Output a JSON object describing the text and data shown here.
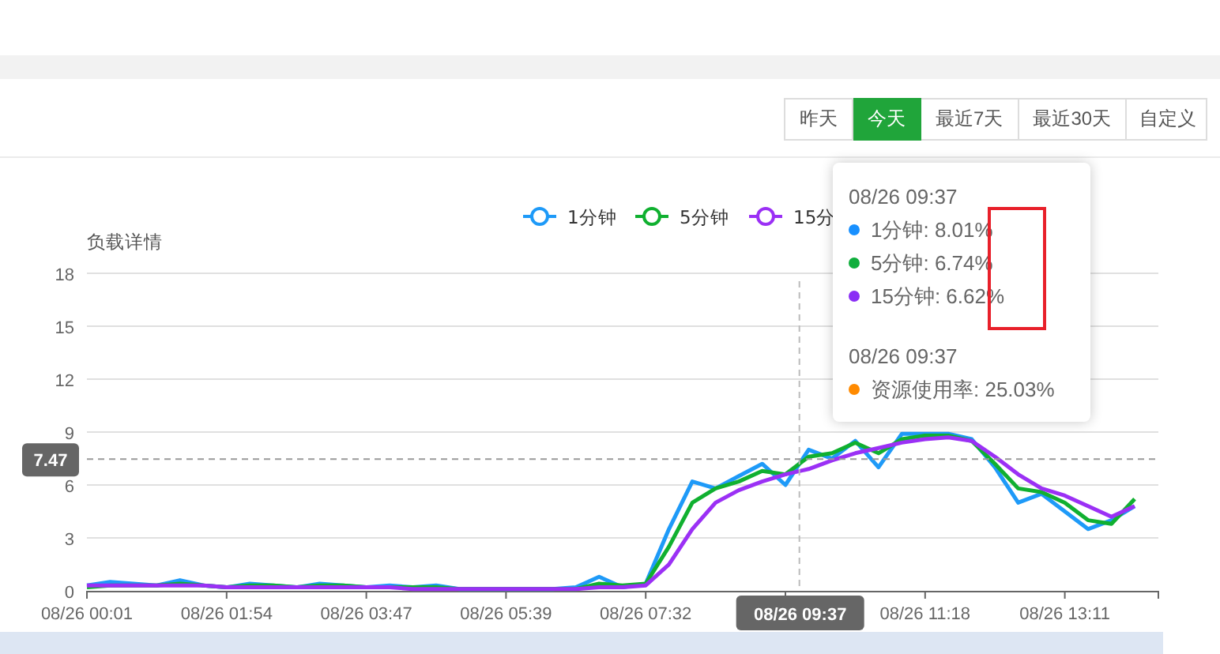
{
  "range_buttons": [
    {
      "label": "昨天",
      "selected": false
    },
    {
      "label": "今天",
      "selected": true
    },
    {
      "label": "最近7天",
      "selected": false
    },
    {
      "label": "最近30天",
      "selected": false
    },
    {
      "label": "自定义",
      "selected": false
    }
  ],
  "chart": {
    "title": "负载详情",
    "x_pointer_label": "08/26 09:37",
    "chart_data": {
      "type": "line",
      "grid": true,
      "legend": true,
      "ylim": [
        0,
        18
      ],
      "yticks": [
        0,
        3,
        6,
        9,
        12,
        15,
        18
      ],
      "ref_lines": [
        {
          "axis": "y",
          "value": 7.47,
          "label": "7.47"
        }
      ],
      "categories": [
        "08/26 00:01",
        null,
        null,
        null,
        null,
        null,
        "08/26 01:54",
        null,
        null,
        null,
        null,
        null,
        "08/26 03:47",
        null,
        null,
        null,
        null,
        null,
        "08/26 05:39",
        null,
        null,
        null,
        null,
        null,
        "08/26 07:32",
        null,
        null,
        null,
        null,
        null,
        null,
        null,
        null,
        null,
        null,
        null,
        "08/26 11:18",
        null,
        null,
        null,
        null,
        null,
        "08/26 13:11",
        null,
        null,
        null
      ],
      "series": [
        {
          "name": "1分钟",
          "color": "#1e9af8",
          "values": [
            0.3,
            0.5,
            0.4,
            0.3,
            0.6,
            0.3,
            0.2,
            0.4,
            0.3,
            0.2,
            0.4,
            0.3,
            0.2,
            0.3,
            0.2,
            0.3,
            0.1,
            0.1,
            0.1,
            0.1,
            0.1,
            0.2,
            0.8,
            0.2,
            0.4,
            3.5,
            6.2,
            5.8,
            6.5,
            7.2,
            6.0,
            8.0,
            7.5,
            8.5,
            7.0,
            8.9,
            8.9,
            8.9,
            8.6,
            7.0,
            5.0,
            5.5,
            4.5,
            3.5,
            4.0,
            4.8
          ]
        },
        {
          "name": "5分钟",
          "color": "#10b030",
          "values": [
            0.2,
            0.3,
            0.3,
            0.3,
            0.4,
            0.3,
            0.2,
            0.3,
            0.3,
            0.2,
            0.3,
            0.3,
            0.2,
            0.2,
            0.2,
            0.2,
            0.1,
            0.1,
            0.1,
            0.1,
            0.1,
            0.1,
            0.4,
            0.3,
            0.4,
            2.5,
            5.0,
            5.8,
            6.2,
            6.8,
            6.6,
            7.6,
            7.8,
            8.4,
            7.8,
            8.6,
            8.8,
            8.8,
            8.5,
            7.2,
            5.8,
            5.6,
            5.0,
            4.0,
            3.8,
            5.2
          ]
        },
        {
          "name": "15分",
          "color": "#9b30f5",
          "values": [
            0.3,
            0.3,
            0.3,
            0.3,
            0.3,
            0.3,
            0.2,
            0.2,
            0.2,
            0.2,
            0.2,
            0.2,
            0.2,
            0.2,
            0.1,
            0.1,
            0.1,
            0.1,
            0.1,
            0.1,
            0.1,
            0.1,
            0.2,
            0.2,
            0.3,
            1.5,
            3.5,
            5.0,
            5.7,
            6.2,
            6.6,
            6.9,
            7.4,
            7.8,
            8.1,
            8.4,
            8.6,
            8.7,
            8.5,
            7.6,
            6.6,
            5.8,
            5.4,
            4.8,
            4.2,
            4.8
          ]
        }
      ]
    }
  },
  "tooltip": {
    "groups": [
      {
        "time": "08/26 09:37",
        "items": [
          {
            "text": "1分钟: 8.01%",
            "color": "#1890ff"
          },
          {
            "text": "5分钟: 6.74%",
            "color": "#0fae3c"
          },
          {
            "text": "15分钟: 6.62%",
            "color": "#8a2ef5"
          }
        ]
      },
      {
        "time": "08/26 09:37",
        "items": [
          {
            "text": "资源使用率: 25.03%",
            "color": "#ff8a00"
          }
        ]
      }
    ]
  }
}
